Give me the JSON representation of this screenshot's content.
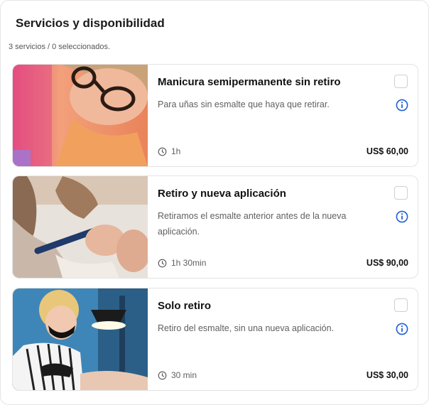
{
  "header": {
    "title": "Servicios y disponibilidad",
    "count": "3 servicios / 0 seleccionados."
  },
  "services": [
    {
      "title": "Manicura semipermanente sin retiro",
      "description": "Para uñas sin esmalte que haya que retirar.",
      "duration": "1h",
      "price": "US$ 60,00",
      "checked": false
    },
    {
      "title": "Retiro y nueva aplicación",
      "description": "Retiramos el esmalte anterior antes de la nueva aplicación.",
      "duration": "1h 30min",
      "price": "US$ 90,00",
      "checked": false
    },
    {
      "title": "Solo retiro",
      "description": "Retiro del esmalte, sin una nueva aplicación.",
      "duration": "30 min",
      "price": "US$ 30,00",
      "checked": false
    }
  ],
  "icons": {
    "clock": "clock-icon",
    "info": "info-icon"
  },
  "colors": {
    "accent": "#1f5fd6",
    "border": "#e3e3e3",
    "muted_text": "#5f5f5f"
  }
}
